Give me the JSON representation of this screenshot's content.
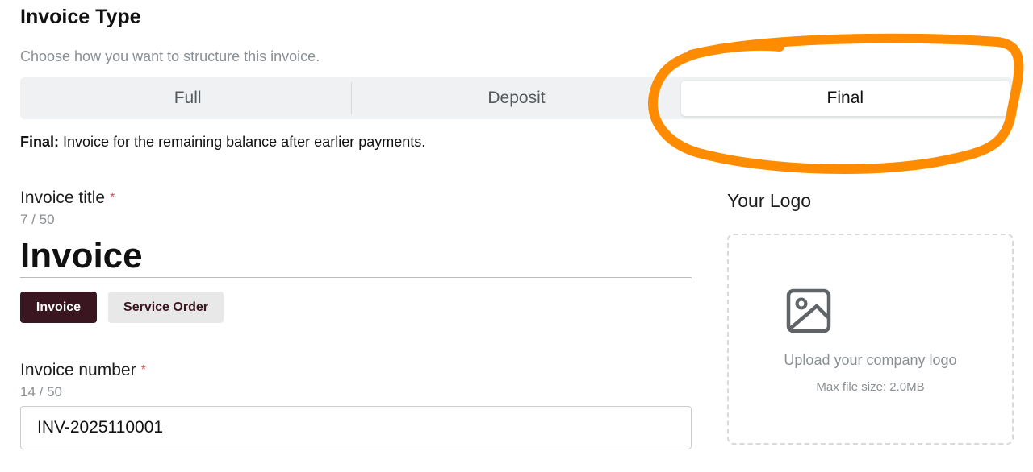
{
  "invoice_type": {
    "title": "Invoice Type",
    "subtitle": "Choose how you want to structure this invoice.",
    "options": [
      {
        "label": "Full"
      },
      {
        "label": "Deposit"
      },
      {
        "label": "Final"
      }
    ],
    "selected": "Final",
    "description_label": "Final:",
    "description_text": " Invoice for the remaining balance after earlier payments."
  },
  "annotation": {
    "color": "#ff8c00",
    "shape": "freehand-ellipse"
  },
  "invoice_title": {
    "label": "Invoice title",
    "required_mark": "*",
    "counter": "7 / 50",
    "value": "Invoice",
    "presets": [
      "Invoice",
      "Service Order"
    ],
    "selected_preset": "Invoice"
  },
  "invoice_number": {
    "label": "Invoice number",
    "required_mark": "*",
    "counter": "14 / 50",
    "value": "INV-2025110001"
  },
  "logo": {
    "label": "Your Logo",
    "icon": "image-icon",
    "upload_text": "Upload your company logo",
    "hint": "Max file size: 2.0MB"
  },
  "colors": {
    "primary_chip": "#3a1620",
    "required": "#d9534f",
    "muted_text": "#8a8f93"
  }
}
